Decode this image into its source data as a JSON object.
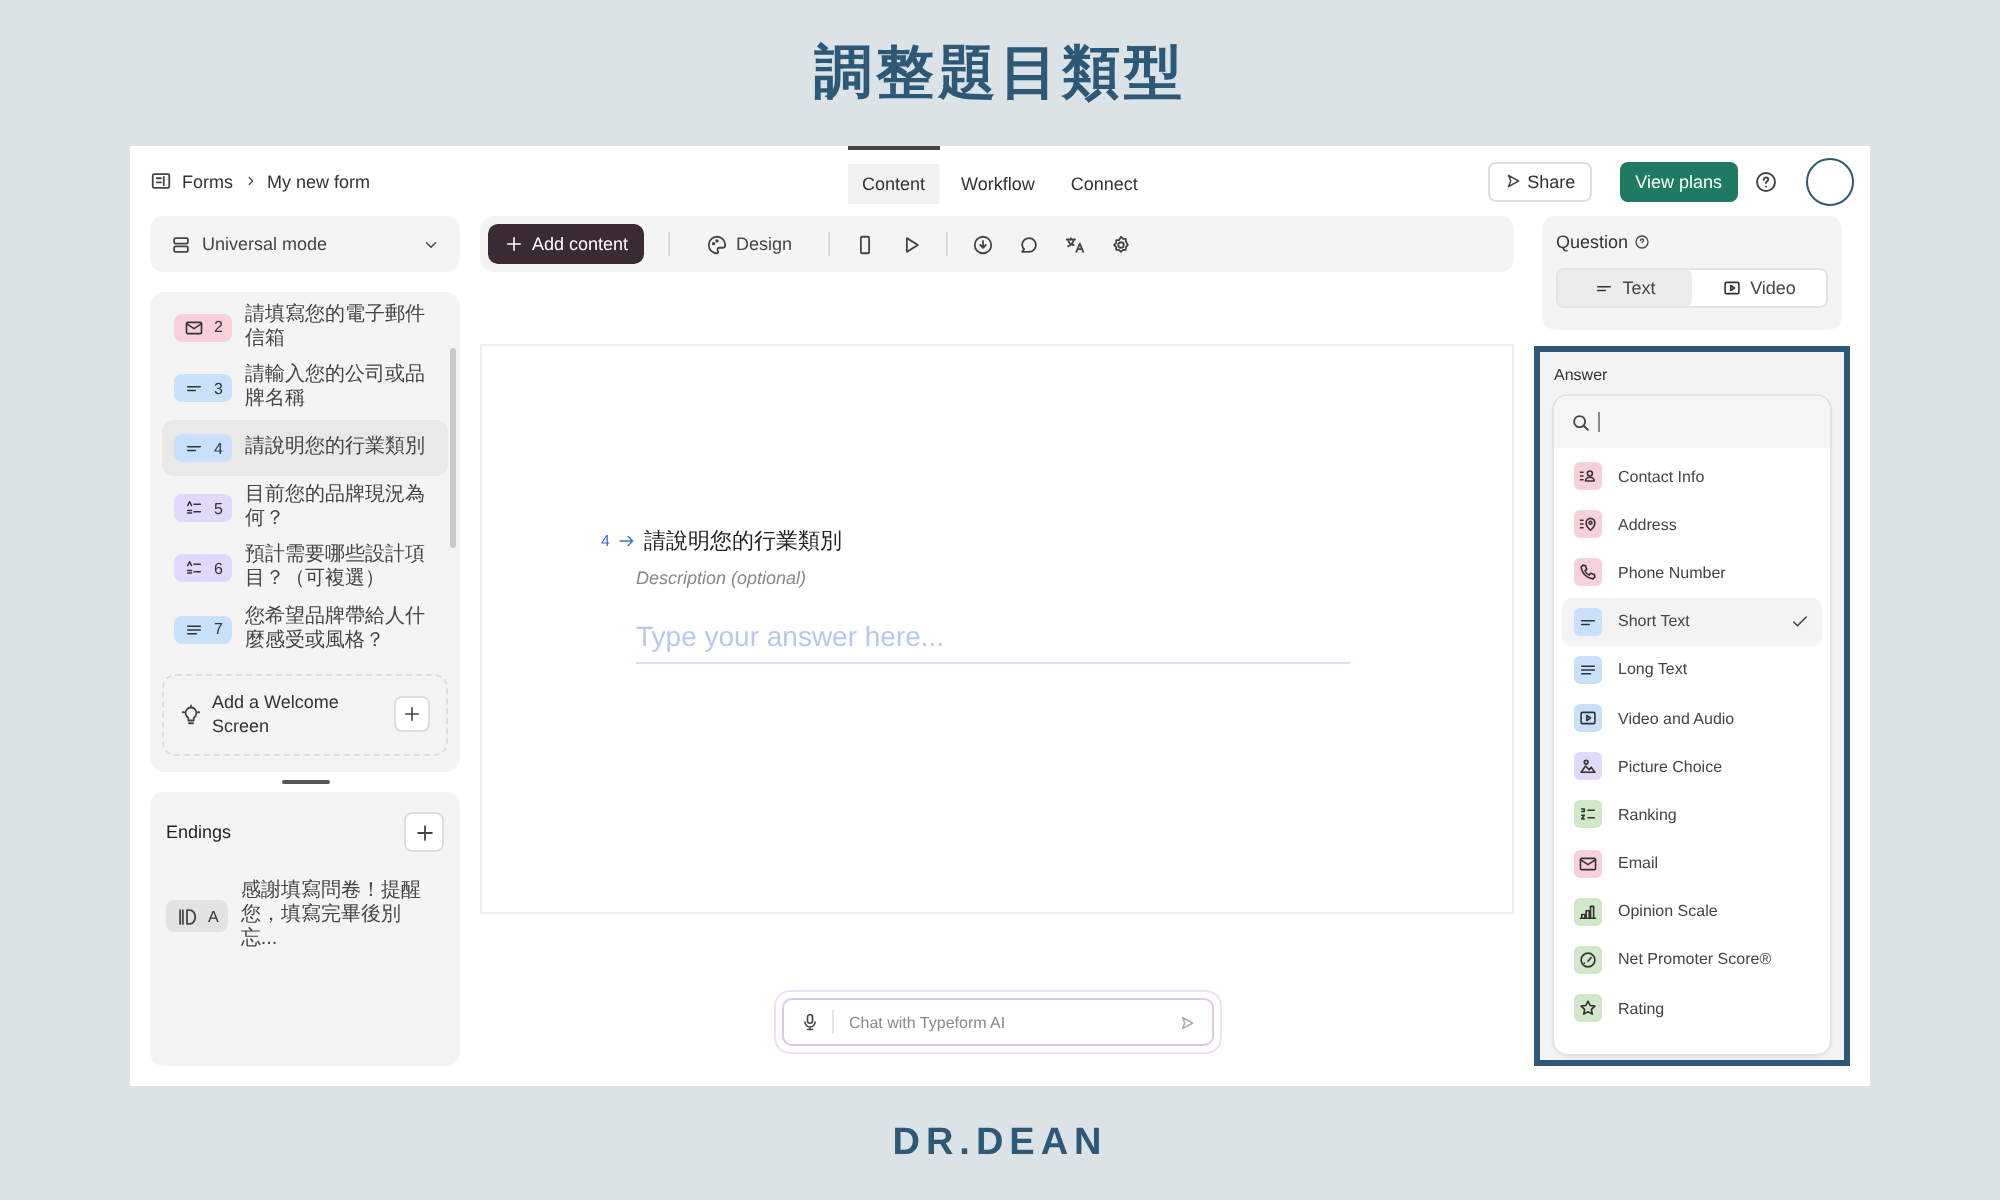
{
  "title": "調整題目類型",
  "breadcrumb": {
    "root": "Forms",
    "page": "My new form"
  },
  "nav_tabs": [
    {
      "label": "Content",
      "selected": true
    },
    {
      "label": "Workflow",
      "selected": false
    },
    {
      "label": "Connect",
      "selected": false
    }
  ],
  "header_buttons": {
    "share": "Share",
    "view_plans": "View plans"
  },
  "mode": "Universal mode",
  "questions": [
    {
      "kind": "email",
      "color": "#f8d0da",
      "number": "2",
      "text": "請填寫您的電子郵件信箱",
      "selected": false
    },
    {
      "kind": "short_text",
      "color": "#c8e0fa",
      "number": "3",
      "text": "請輸入您的公司或品牌名稱",
      "selected": false
    },
    {
      "kind": "short_text",
      "color": "#c8e0fa",
      "number": "4",
      "text": "請說明您的行業類別",
      "selected": true
    },
    {
      "kind": "choice",
      "color": "#e0d9fb",
      "number": "5",
      "text": "目前您的品牌現況為何？",
      "selected": false
    },
    {
      "kind": "choice",
      "color": "#e0d9fb",
      "number": "6",
      "text": "預計需要哪些設計項目？（可複選）",
      "selected": false
    },
    {
      "kind": "long_text",
      "color": "#c8e0fa",
      "number": "7",
      "text": "您希望品牌帶給人什麼感受或風格？",
      "selected": false
    }
  ],
  "welcome": "Add a Welcome Screen",
  "endings": {
    "title": "Endings",
    "items": [
      {
        "letter": "A",
        "text": "感謝填寫問卷！提醒您，填寫完畢後別忘..."
      }
    ]
  },
  "toolbar": {
    "add_content": "Add content",
    "design": "Design"
  },
  "canvas": {
    "number": "4",
    "question": "請說明您的行業類別",
    "description": "Description (optional)",
    "answer_placeholder": "Type your answer here..."
  },
  "chat": {
    "placeholder": "Chat with Typeform AI"
  },
  "question_panel": {
    "title": "Question",
    "options": [
      {
        "kind": "text",
        "label": "Text",
        "selected": true
      },
      {
        "kind": "video",
        "label": "Video",
        "selected": false
      }
    ]
  },
  "answer_panel": {
    "title": "Answer",
    "types": [
      {
        "kind": "contact",
        "color": "#f8d0da",
        "label": "Contact Info",
        "selected": false
      },
      {
        "kind": "address",
        "color": "#f8d0da",
        "label": "Address",
        "selected": false
      },
      {
        "kind": "phone",
        "color": "#f8d0da",
        "label": "Phone Number",
        "selected": false
      },
      {
        "kind": "short_text",
        "color": "#c8e0fa",
        "label": "Short Text",
        "selected": true
      },
      {
        "kind": "long_text",
        "color": "#c8e0fa",
        "label": "Long Text",
        "selected": false
      },
      {
        "kind": "video",
        "color": "#c8e0fa",
        "label": "Video and Audio",
        "selected": false
      },
      {
        "kind": "picture",
        "color": "#e0d9fb",
        "label": "Picture Choice",
        "selected": false
      },
      {
        "kind": "ranking",
        "color": "#cfe8c8",
        "label": "Ranking",
        "selected": false
      },
      {
        "kind": "email",
        "color": "#f8d0da",
        "label": "Email",
        "selected": false
      },
      {
        "kind": "opinion_scale",
        "color": "#cfe8c8",
        "label": "Opinion Scale",
        "selected": false
      },
      {
        "kind": "nps",
        "color": "#cfe8c8",
        "label": "Net Promoter Score®",
        "selected": false
      },
      {
        "kind": "rating",
        "color": "#cfe8c8",
        "label": "Rating",
        "selected": false
      }
    ]
  },
  "logo": "DR.DEAN"
}
